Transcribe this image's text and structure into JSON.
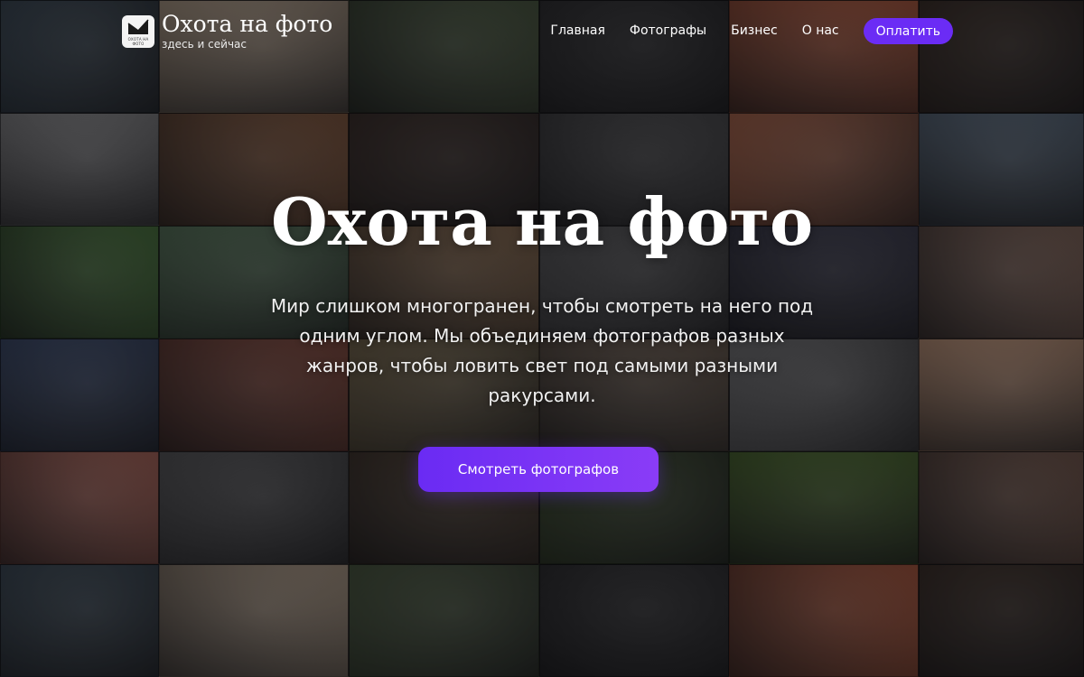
{
  "site": {
    "title": "Охота на фото",
    "subtitle": "здесь и сейчас",
    "logo_text": "ОХОТА НА ФОТО"
  },
  "nav": {
    "items": [
      "Главная",
      "Фотографы",
      "Бизнес",
      "О нас"
    ],
    "pay_label": "Оплатить"
  },
  "hero": {
    "title": "Охота на фото",
    "text": "Мир слишком многогранен, чтобы смотреть на него под одним углом. Мы объединяем фотографов разных жанров, чтобы ловить свет под самыми разными ракурсами.",
    "cta_label": "Смотреть фотографов"
  },
  "colors": {
    "accent": "#6b2cf5",
    "tiles": [
      "#3b4a55",
      "#b8a38a",
      "#4a5a3c",
      "#2c2c2c",
      "#b85a3a",
      "#3a2c22",
      "#8a8a8a",
      "#8a5a3a",
      "#3a2c24",
      "#4a4a4a",
      "#b86a4a",
      "#5a6a7a",
      "#4a7a3a",
      "#5a7a5a",
      "#8a6a4a",
      "#5a5a5a",
      "#3a3a4a",
      "#8a6a5a",
      "#3a4a6a",
      "#8a4a3a",
      "#7a6a4a",
      "#6a5a4a",
      "#7a7a7a",
      "#c89a7a",
      "#b86a5a",
      "#5a5a5a",
      "#4a3a2a",
      "#3a4a2a",
      "#4a6a2a",
      "#7a5a4a"
    ]
  }
}
